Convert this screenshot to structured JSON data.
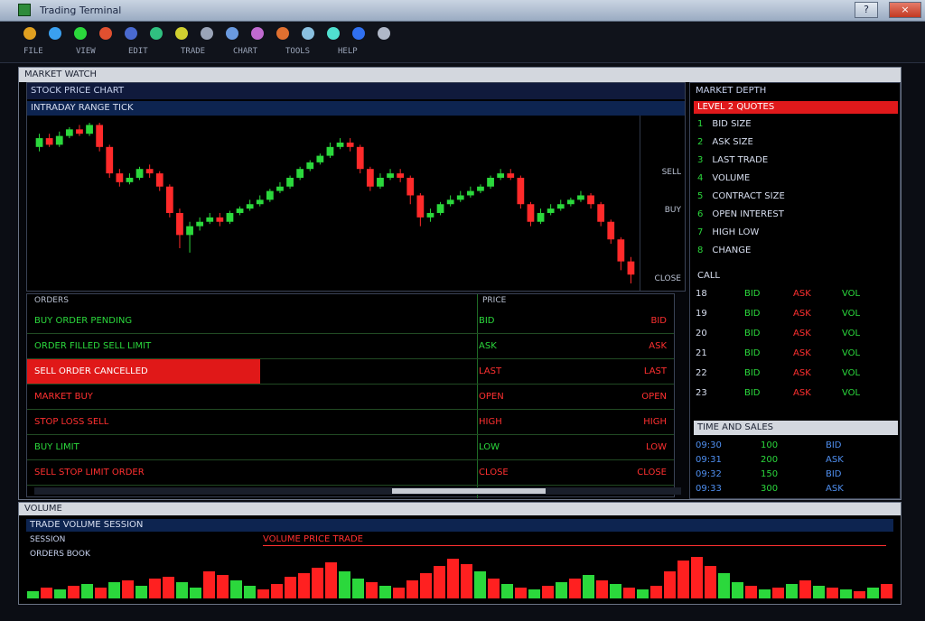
{
  "window": {
    "title": "Trading Terminal",
    "help_btn": "?",
    "close_btn": "×"
  },
  "toolbar": {
    "icons": [
      "refresh-icon",
      "globe-icon",
      "chart-icon",
      "news-icon",
      "book-icon",
      "quote-icon",
      "alert-icon",
      "settings-icon",
      "cloud-icon",
      "user-icon",
      "print-icon",
      "tool-icon",
      "sync-icon",
      "web-icon",
      "window-icon"
    ],
    "labels": [
      "FILE",
      "VIEW",
      "EDIT",
      "TRADE",
      "CHART",
      "TOOLS",
      "HELP"
    ]
  },
  "workspace": {
    "title": "MARKET WATCH"
  },
  "chart": {
    "header": "STOCK PRICE CHART",
    "subheader": "INTRADAY  RANGE  TICK",
    "axis_labels": [
      "SELL",
      "BUY",
      "CLOSE"
    ],
    "candles": [
      {
        "o": 70,
        "c": 74,
        "h": 76,
        "l": 68
      },
      {
        "o": 74,
        "c": 71,
        "h": 76,
        "l": 70
      },
      {
        "o": 71,
        "c": 75,
        "h": 77,
        "l": 70
      },
      {
        "o": 75,
        "c": 78,
        "h": 79,
        "l": 74
      },
      {
        "o": 78,
        "c": 76,
        "h": 80,
        "l": 75
      },
      {
        "o": 76,
        "c": 80,
        "h": 81,
        "l": 75
      },
      {
        "o": 80,
        "c": 70,
        "h": 81,
        "l": 68
      },
      {
        "o": 70,
        "c": 58,
        "h": 71,
        "l": 56
      },
      {
        "o": 58,
        "c": 54,
        "h": 60,
        "l": 52
      },
      {
        "o": 54,
        "c": 56,
        "h": 58,
        "l": 53
      },
      {
        "o": 56,
        "c": 60,
        "h": 61,
        "l": 55
      },
      {
        "o": 60,
        "c": 58,
        "h": 62,
        "l": 56
      },
      {
        "o": 58,
        "c": 52,
        "h": 59,
        "l": 50
      },
      {
        "o": 52,
        "c": 40,
        "h": 53,
        "l": 38
      },
      {
        "o": 40,
        "c": 30,
        "h": 42,
        "l": 24
      },
      {
        "o": 30,
        "c": 34,
        "h": 36,
        "l": 22
      },
      {
        "o": 34,
        "c": 36,
        "h": 38,
        "l": 32
      },
      {
        "o": 36,
        "c": 38,
        "h": 40,
        "l": 35
      },
      {
        "o": 38,
        "c": 36,
        "h": 40,
        "l": 34
      },
      {
        "o": 36,
        "c": 40,
        "h": 41,
        "l": 35
      },
      {
        "o": 40,
        "c": 42,
        "h": 43,
        "l": 39
      },
      {
        "o": 42,
        "c": 44,
        "h": 46,
        "l": 41
      },
      {
        "o": 44,
        "c": 46,
        "h": 48,
        "l": 43
      },
      {
        "o": 46,
        "c": 50,
        "h": 51,
        "l": 45
      },
      {
        "o": 50,
        "c": 52,
        "h": 54,
        "l": 49
      },
      {
        "o": 52,
        "c": 56,
        "h": 57,
        "l": 51
      },
      {
        "o": 56,
        "c": 60,
        "h": 61,
        "l": 55
      },
      {
        "o": 60,
        "c": 63,
        "h": 64,
        "l": 59
      },
      {
        "o": 63,
        "c": 66,
        "h": 67,
        "l": 62
      },
      {
        "o": 66,
        "c": 70,
        "h": 72,
        "l": 65
      },
      {
        "o": 70,
        "c": 72,
        "h": 74,
        "l": 69
      },
      {
        "o": 72,
        "c": 70,
        "h": 74,
        "l": 68
      },
      {
        "o": 70,
        "c": 60,
        "h": 71,
        "l": 58
      },
      {
        "o": 60,
        "c": 52,
        "h": 61,
        "l": 50
      },
      {
        "o": 52,
        "c": 56,
        "h": 58,
        "l": 51
      },
      {
        "o": 56,
        "c": 58,
        "h": 60,
        "l": 55
      },
      {
        "o": 58,
        "c": 56,
        "h": 60,
        "l": 54
      },
      {
        "o": 56,
        "c": 48,
        "h": 57,
        "l": 44
      },
      {
        "o": 48,
        "c": 38,
        "h": 49,
        "l": 34
      },
      {
        "o": 38,
        "c": 40,
        "h": 42,
        "l": 36
      },
      {
        "o": 40,
        "c": 44,
        "h": 45,
        "l": 39
      },
      {
        "o": 44,
        "c": 46,
        "h": 48,
        "l": 43
      },
      {
        "o": 46,
        "c": 48,
        "h": 50,
        "l": 45
      },
      {
        "o": 48,
        "c": 50,
        "h": 52,
        "l": 47
      },
      {
        "o": 50,
        "c": 52,
        "h": 53,
        "l": 49
      },
      {
        "o": 52,
        "c": 56,
        "h": 57,
        "l": 51
      },
      {
        "o": 56,
        "c": 58,
        "h": 60,
        "l": 55
      },
      {
        "o": 58,
        "c": 56,
        "h": 60,
        "l": 55
      },
      {
        "o": 56,
        "c": 44,
        "h": 57,
        "l": 42
      },
      {
        "o": 44,
        "c": 36,
        "h": 45,
        "l": 34
      },
      {
        "o": 36,
        "c": 40,
        "h": 42,
        "l": 35
      },
      {
        "o": 40,
        "c": 42,
        "h": 44,
        "l": 39
      },
      {
        "o": 42,
        "c": 44,
        "h": 46,
        "l": 41
      },
      {
        "o": 44,
        "c": 46,
        "h": 47,
        "l": 43
      },
      {
        "o": 46,
        "c": 48,
        "h": 50,
        "l": 45
      },
      {
        "o": 48,
        "c": 44,
        "h": 49,
        "l": 42
      },
      {
        "o": 44,
        "c": 36,
        "h": 45,
        "l": 34
      },
      {
        "o": 36,
        "c": 28,
        "h": 37,
        "l": 26
      },
      {
        "o": 28,
        "c": 18,
        "h": 29,
        "l": 14
      },
      {
        "o": 18,
        "c": 12,
        "h": 20,
        "l": 8
      }
    ]
  },
  "orders": {
    "col_a": "ORDERS",
    "col_b": "PRICE",
    "rows": [
      {
        "label": "BUY ORDER PENDING",
        "mid": "BID",
        "right": "BID",
        "color": "green"
      },
      {
        "label": "ORDER FILLED SELL LIMIT",
        "mid": "ASK",
        "right": "ASK",
        "color": "green"
      },
      {
        "label": "SELL ORDER CANCELLED",
        "mid": "LAST",
        "right": "LAST",
        "color": "red"
      },
      {
        "label": "MARKET BUY",
        "mid": "OPEN",
        "right": "OPEN",
        "color": "red"
      },
      {
        "label": "STOP LOSS SELL",
        "mid": "HIGH",
        "right": "HIGH",
        "color": "red"
      },
      {
        "label": "BUY LIMIT",
        "mid": "LOW",
        "right": "LOW",
        "color": "green"
      },
      {
        "label": "SELL STOP LIMIT ORDER",
        "mid": "CLOSE",
        "right": "CLOSE",
        "color": "red"
      }
    ]
  },
  "right_panel": {
    "header": "MARKET DEPTH",
    "red_bar": "LEVEL 2 QUOTES",
    "lines": [
      {
        "num": "1",
        "text": "BID SIZE"
      },
      {
        "num": "2",
        "text": "ASK SIZE"
      },
      {
        "num": "3",
        "text": "LAST TRADE"
      },
      {
        "num": "4",
        "text": "VOLUME"
      },
      {
        "num": "5",
        "text": "CONTRACT SIZE"
      },
      {
        "num": "6",
        "text": "OPEN INTEREST"
      },
      {
        "num": "7",
        "text": "HIGH LOW"
      },
      {
        "num": "8",
        "text": "CHANGE"
      }
    ],
    "grid_label": "CALL",
    "grid_rows": [
      [
        "18",
        "BID",
        "ASK",
        "VOL"
      ],
      [
        "19",
        "BID",
        "ASK",
        "VOL"
      ],
      [
        "20",
        "BID",
        "ASK",
        "VOL"
      ],
      [
        "21",
        "BID",
        "ASK",
        "VOL"
      ],
      [
        "22",
        "BID",
        "ASK",
        "VOL"
      ],
      [
        "23",
        "BID",
        "ASK",
        "VOL"
      ]
    ],
    "subtitle": "TIME AND SALES",
    "blue_rows": [
      [
        "09:30",
        "100",
        "BID"
      ],
      [
        "09:31",
        "200",
        "ASK"
      ],
      [
        "09:32",
        "150",
        "BID"
      ],
      [
        "09:33",
        "300",
        "ASK"
      ]
    ]
  },
  "volume": {
    "title": "VOLUME",
    "header": "TRADE VOLUME SESSION",
    "red_row": "VOLUME PRICE TRADE",
    "notes": [
      "SESSION",
      "ORDERS BOOK"
    ],
    "bars": [
      {
        "v": 8,
        "up": true
      },
      {
        "v": 12,
        "up": false
      },
      {
        "v": 10,
        "up": true
      },
      {
        "v": 14,
        "up": false
      },
      {
        "v": 16,
        "up": true
      },
      {
        "v": 12,
        "up": false
      },
      {
        "v": 18,
        "up": true
      },
      {
        "v": 20,
        "up": false
      },
      {
        "v": 14,
        "up": true
      },
      {
        "v": 22,
        "up": false
      },
      {
        "v": 24,
        "up": false
      },
      {
        "v": 18,
        "up": true
      },
      {
        "v": 12,
        "up": true
      },
      {
        "v": 30,
        "up": false
      },
      {
        "v": 26,
        "up": false
      },
      {
        "v": 20,
        "up": true
      },
      {
        "v": 14,
        "up": true
      },
      {
        "v": 10,
        "up": false
      },
      {
        "v": 16,
        "up": false
      },
      {
        "v": 24,
        "up": false
      },
      {
        "v": 28,
        "up": false
      },
      {
        "v": 34,
        "up": false
      },
      {
        "v": 40,
        "up": false
      },
      {
        "v": 30,
        "up": true
      },
      {
        "v": 22,
        "up": true
      },
      {
        "v": 18,
        "up": false
      },
      {
        "v": 14,
        "up": true
      },
      {
        "v": 12,
        "up": false
      },
      {
        "v": 20,
        "up": false
      },
      {
        "v": 28,
        "up": false
      },
      {
        "v": 36,
        "up": false
      },
      {
        "v": 44,
        "up": false
      },
      {
        "v": 38,
        "up": false
      },
      {
        "v": 30,
        "up": true
      },
      {
        "v": 22,
        "up": false
      },
      {
        "v": 16,
        "up": true
      },
      {
        "v": 12,
        "up": false
      },
      {
        "v": 10,
        "up": true
      },
      {
        "v": 14,
        "up": false
      },
      {
        "v": 18,
        "up": true
      },
      {
        "v": 22,
        "up": false
      },
      {
        "v": 26,
        "up": true
      },
      {
        "v": 20,
        "up": false
      },
      {
        "v": 16,
        "up": true
      },
      {
        "v": 12,
        "up": false
      },
      {
        "v": 10,
        "up": true
      },
      {
        "v": 14,
        "up": false
      },
      {
        "v": 30,
        "up": false
      },
      {
        "v": 42,
        "up": false
      },
      {
        "v": 46,
        "up": false
      },
      {
        "v": 36,
        "up": false
      },
      {
        "v": 28,
        "up": true
      },
      {
        "v": 18,
        "up": true
      },
      {
        "v": 14,
        "up": false
      },
      {
        "v": 10,
        "up": true
      },
      {
        "v": 12,
        "up": false
      },
      {
        "v": 16,
        "up": true
      },
      {
        "v": 20,
        "up": false
      },
      {
        "v": 14,
        "up": true
      },
      {
        "v": 12,
        "up": false
      },
      {
        "v": 10,
        "up": true
      },
      {
        "v": 8,
        "up": false
      },
      {
        "v": 12,
        "up": true
      },
      {
        "v": 16,
        "up": false
      }
    ]
  }
}
